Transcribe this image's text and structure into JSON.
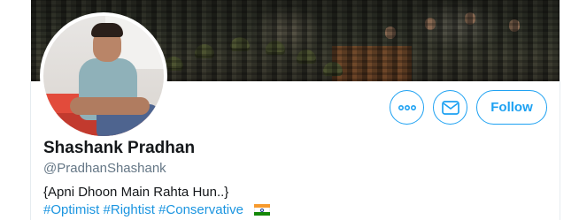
{
  "profile": {
    "display_name": "Shashank Pradhan",
    "handle": "@PradhanShashank",
    "bio_line1": "{Apni Dhoon Main Rahta Hun..}",
    "hashtags": [
      "#Optimist",
      "#Rightist",
      "#Conservative"
    ],
    "bio_emoji": "indian-flag-emoji"
  },
  "actions": {
    "more_icon": "more-horizontal-icon",
    "message_icon": "envelope-icon",
    "follow_label": "Follow"
  },
  "colors": {
    "accent": "#1da1f2",
    "hashtag": "#1b95e0",
    "name": "#14171a",
    "secondary_text": "#657786"
  },
  "images": {
    "banner": "crowd-of-police-banner",
    "avatar": "profile-photo"
  }
}
